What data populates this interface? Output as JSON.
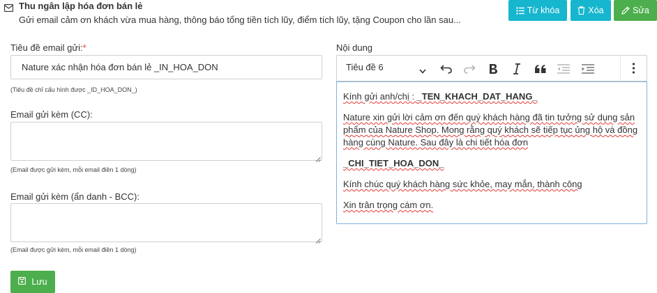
{
  "header": {
    "title": "Thu ngân lập hóa đơn bán lẻ",
    "description": "Gửi email cảm ơn khách vừa mua hàng, thông báo tổng tiền tích lũy, điểm tích lũy, tặng Coupon cho lần sau..."
  },
  "actions": {
    "keywords_label": "Từ khóa",
    "delete_label": "Xóa",
    "edit_label": "Sửa"
  },
  "form": {
    "subject_label": "Tiêu đề email gửi:",
    "subject_required_mark": "*",
    "subject_value": "Nature xác nhận hóa đơn bán lẻ _IN_HOA_DON",
    "subject_hint": "(Tiêu đề chỉ cấu hình được _ID_HOA_DON_)",
    "cc_label": "Email gửi kèm (CC):",
    "cc_hint": "(Email được gửi kèm, mỗi email điền 1 dòng)",
    "bcc_label": "Email gửi kèm (ẩn danh - BCC):",
    "bcc_hint": "(Email được gửi kèm, mỗi email điền 1 dòng)",
    "save_label": "Lưu"
  },
  "editor": {
    "label": "Nội dung",
    "heading_select": "Tiêu đề 6",
    "toolbar_icons": [
      "undo-icon",
      "redo-icon",
      "bold-icon",
      "italic-icon",
      "quote-icon",
      "outdent-icon",
      "indent-icon",
      "more-vertical-icon"
    ],
    "content": {
      "greeting_prefix": "Kính gửi anh/chị : ",
      "greeting_tag": "_TEN_KHACH_DAT_HANG_",
      "thanks": "Nature xin gửi lời cảm ơn đến quý khách hàng đã tin tưởng sử dụng sản phẩm của Nature Shop. Mong rằng quý khách sẽ tiếp tục ủng hộ và đồng hàng cùng Nature. Sau đây là chi tiết hóa đơn",
      "invoice_tag": "_CHI_TIET_HOA_DON_",
      "wishes": "Kính chúc quý khách hàng sức khỏe, may mắn, thành công",
      "closing": "Xin trân trọng cám ơn."
    }
  },
  "colors": {
    "info": "#17b6cf",
    "success": "#4cae4c",
    "required": "#e53935",
    "editor_focus_border": "#7fb0e0"
  }
}
